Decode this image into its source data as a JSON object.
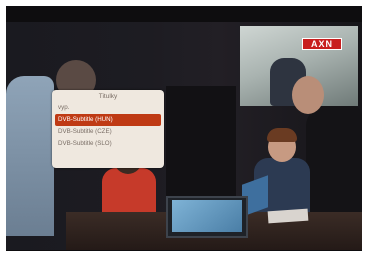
{
  "channel_logo": "AXN",
  "subtitle_menu": {
    "title": "Titulky",
    "items": [
      {
        "label": "vyp.",
        "selected": false
      },
      {
        "label": "DVB-Subtitle (HUN)",
        "selected": true
      },
      {
        "label": "DVB-Subtitle (CZE)",
        "selected": false
      },
      {
        "label": "DVB-Subtitle (SLO)",
        "selected": false
      }
    ],
    "colors": {
      "background": "#efe8df",
      "text": "#7a6e66",
      "highlight": "#bf3a14",
      "highlight_text": "#ffffff"
    }
  }
}
